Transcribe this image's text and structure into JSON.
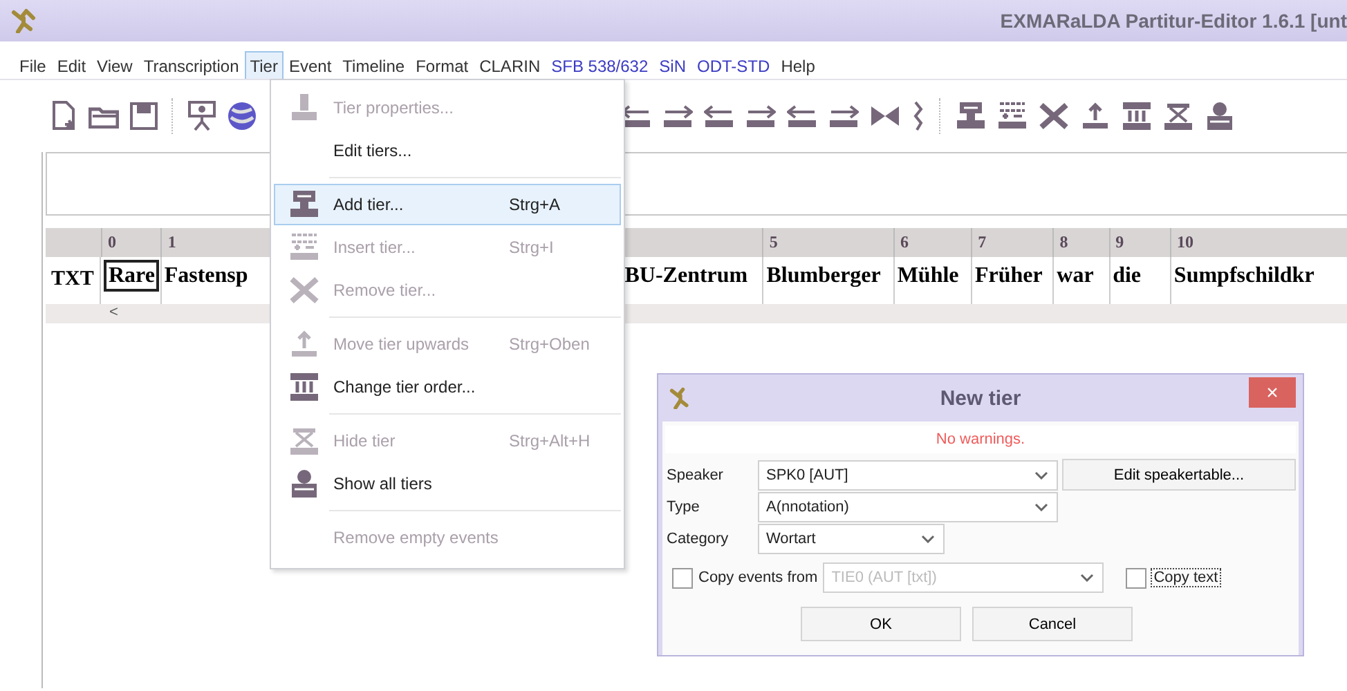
{
  "window": {
    "title": "EXMARaLDA Partitur-Editor 1.6.1 [unt"
  },
  "menu_bar": [
    {
      "label": "File",
      "selected": false,
      "color": "#333333"
    },
    {
      "label": "Edit",
      "selected": false,
      "color": "#333333"
    },
    {
      "label": "View",
      "selected": false,
      "color": "#333333"
    },
    {
      "label": "Transcription",
      "selected": false,
      "color": "#333333"
    },
    {
      "label": "Tier",
      "selected": true,
      "color": "#333333"
    },
    {
      "label": "Event",
      "selected": false,
      "color": "#333333"
    },
    {
      "label": "Timeline",
      "selected": false,
      "color": "#333333"
    },
    {
      "label": "Format",
      "selected": false,
      "color": "#333333"
    },
    {
      "label": "CLARIN",
      "selected": false,
      "color": "#333333"
    },
    {
      "label": "SFB 538/632",
      "selected": false,
      "color": "#3b3bc4"
    },
    {
      "label": "SiN",
      "selected": false,
      "color": "#3b3bc4"
    },
    {
      "label": "ODT-STD",
      "selected": false,
      "color": "#3b3bc4"
    },
    {
      "label": "Help",
      "selected": false,
      "color": "#333333"
    }
  ],
  "tier_menu": {
    "items": [
      {
        "kind": "item",
        "label": "Tier properties...",
        "disabled": true,
        "selected": false
      },
      {
        "kind": "item",
        "label": "Edit tiers...",
        "disabled": false,
        "selected": false
      },
      {
        "kind": "separator"
      },
      {
        "kind": "item",
        "label": "Add tier...",
        "shortcut": "Strg+A",
        "disabled": false,
        "selected": true
      },
      {
        "kind": "item",
        "label": "Insert tier...",
        "shortcut": "Strg+I",
        "disabled": true,
        "selected": false
      },
      {
        "kind": "item",
        "label": "Remove tier...",
        "disabled": true,
        "selected": false
      },
      {
        "kind": "separator"
      },
      {
        "kind": "item",
        "label": "Move tier upwards",
        "shortcut": "Strg+Oben",
        "disabled": true,
        "selected": false
      },
      {
        "kind": "item",
        "label": "Change tier order...",
        "disabled": false,
        "selected": false
      },
      {
        "kind": "separator"
      },
      {
        "kind": "item",
        "label": "Hide tier",
        "shortcut": "Strg+Alt+H",
        "disabled": true,
        "selected": false
      },
      {
        "kind": "item",
        "label": "Show all tiers",
        "disabled": false,
        "selected": false
      },
      {
        "kind": "separator"
      },
      {
        "kind": "item",
        "label": "Remove empty events",
        "disabled": true,
        "selected": false
      }
    ]
  },
  "partitur": {
    "tier_label": "TXT",
    "scroll_mark": "<",
    "columns": [
      {
        "number": "0",
        "text": "Rare",
        "selected": true
      },
      {
        "number": "1",
        "text": "Fastensp",
        "selected": false
      },
      {
        "text": "BU-Zentrum",
        "selected": false
      },
      {
        "number": "5",
        "text": "Blumberger",
        "selected": false
      },
      {
        "number": "6",
        "text": "Mühle",
        "selected": false
      },
      {
        "number": "7",
        "text": "Früher",
        "selected": false
      },
      {
        "number": "8",
        "text": "war",
        "selected": false
      },
      {
        "number": "9",
        "text": "die",
        "selected": false
      },
      {
        "number": "10",
        "text": "Sumpfschildkr",
        "selected": false
      }
    ]
  },
  "dialog": {
    "title": "New tier",
    "close": "×",
    "warning": "No warnings.",
    "fields": [
      {
        "label": "Speaker",
        "value": "SPK0 [AUT]"
      },
      {
        "label": "Type",
        "value": "A(nnotation)"
      },
      {
        "label": "Category",
        "value": "Wortart"
      }
    ],
    "speaker_button": "Edit speakertable...",
    "copy_events": {
      "label": "Copy events from",
      "checked": false,
      "source": "TIE0 (AUT [txt])",
      "source_disabled": true
    },
    "copy_text": {
      "label": "Copy text",
      "checked": false,
      "focused": true
    },
    "buttons": [
      "OK",
      "Cancel"
    ]
  }
}
